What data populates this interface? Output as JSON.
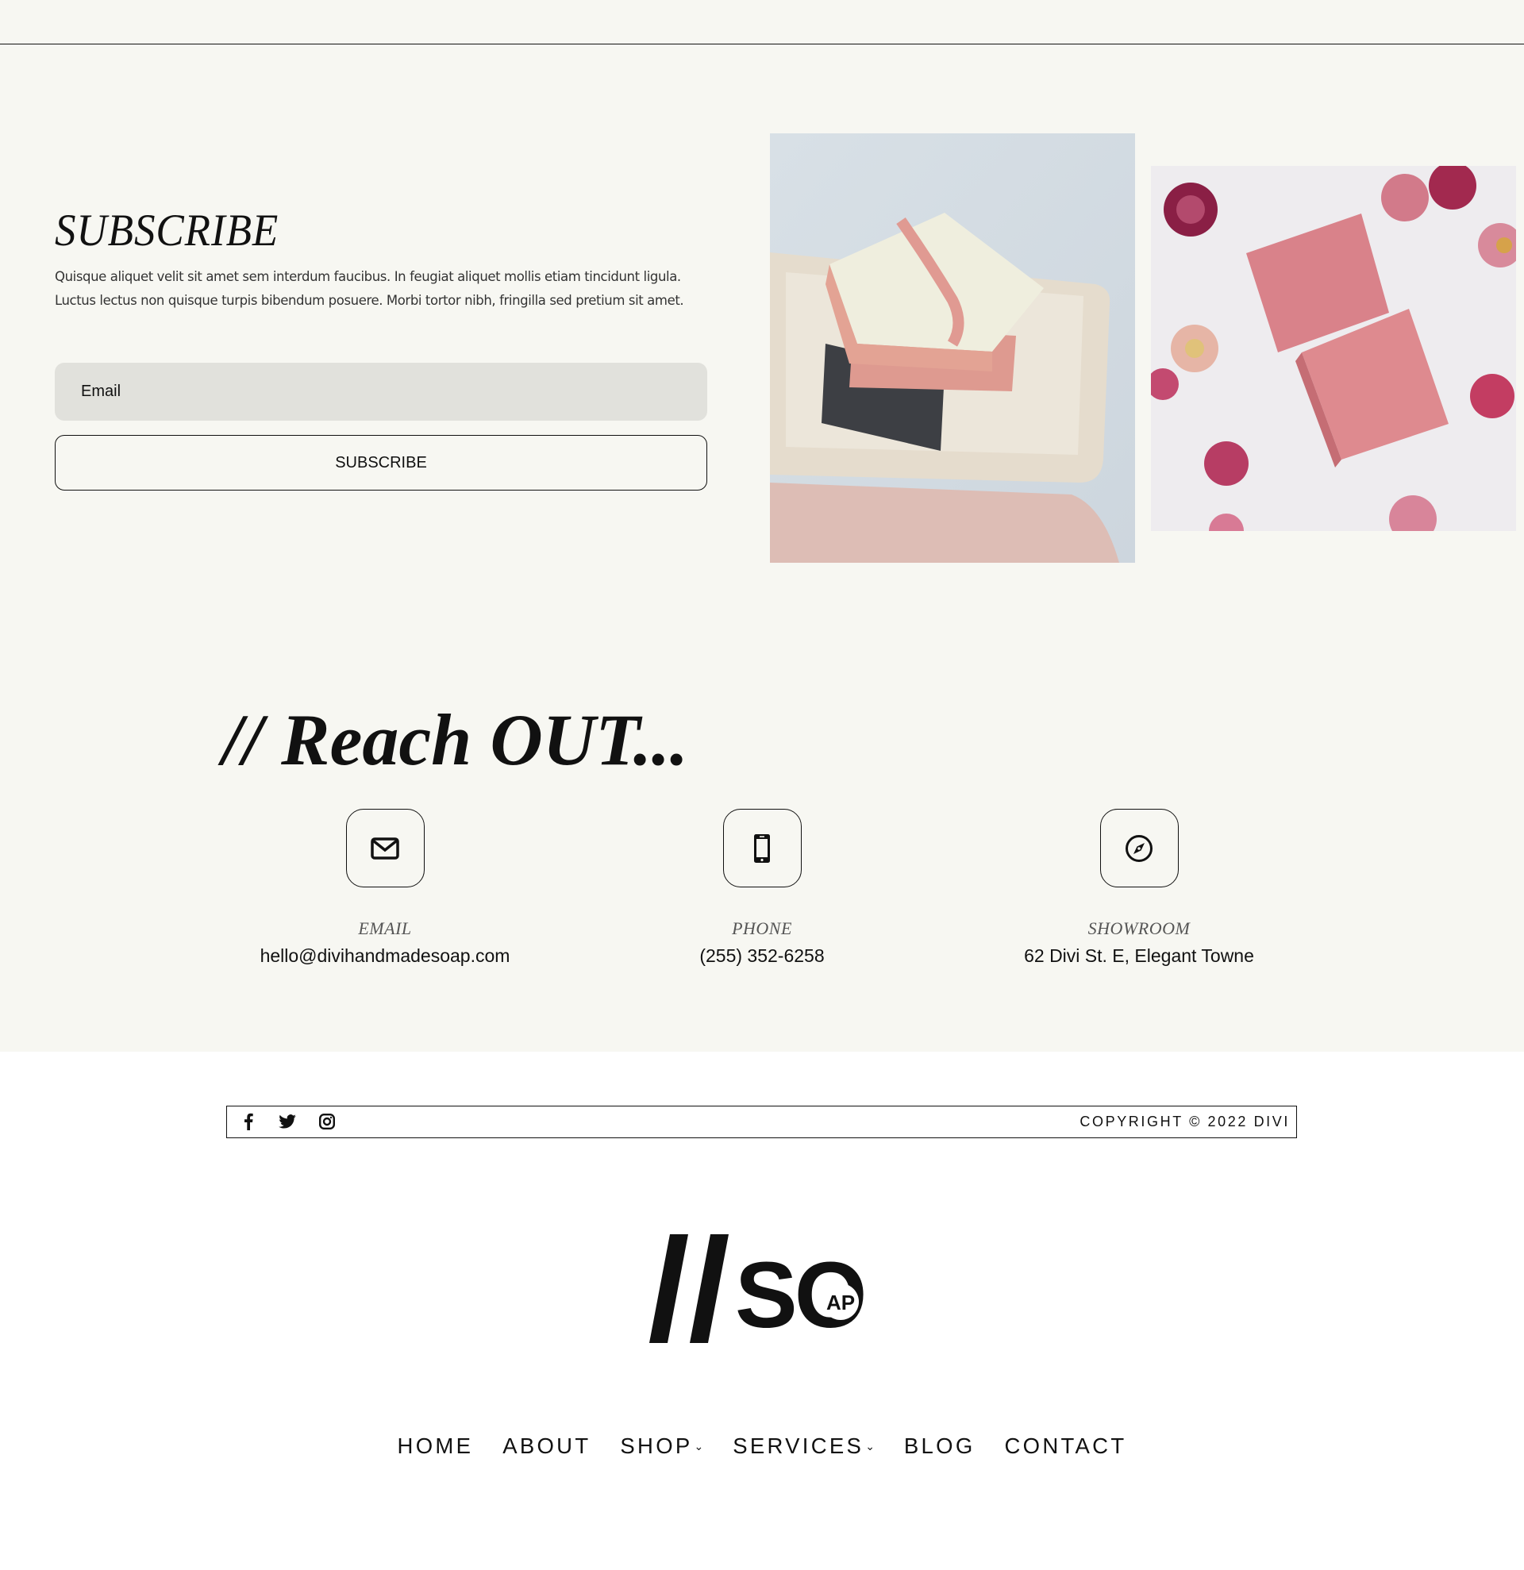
{
  "subscribe": {
    "title": "SUBSCRIBE",
    "text": "Quisque aliquet velit sit amet sem interdum faucibus. In feugiat aliquet mollis etiam tincidunt ligula. Luctus lectus non quisque turpis bibendum posuere. Morbi tortor nibh, fringilla sed pretium sit amet.",
    "email_placeholder": "Email",
    "email_value": "",
    "button_label": "SUBSCRIBE"
  },
  "images": [
    {
      "name": "stacked-soap-bars-photo",
      "alt": "Stacked handmade soap bars on a stone tray"
    },
    {
      "name": "pink-soap-with-flowers-photo",
      "alt": "Pink soap bars with dried flowers"
    }
  ],
  "reach": {
    "title": "// Reach OUT...",
    "items": [
      {
        "icon": "envelope-icon",
        "label": "EMAIL",
        "value": "hello@divihandmadesoap.com"
      },
      {
        "icon": "smartphone-icon",
        "label": "PHONE",
        "value": "(255) 352-6258"
      },
      {
        "icon": "compass-icon",
        "label": "SHOWROOM",
        "value": "62 Divi St. E, Elegant Towne"
      }
    ]
  },
  "footer": {
    "social": [
      {
        "icon": "facebook-icon",
        "label": "Facebook"
      },
      {
        "icon": "twitter-icon",
        "label": "Twitter"
      },
      {
        "icon": "instagram-icon",
        "label": "Instagram"
      }
    ],
    "copyright": "COPYRIGHT © 2022 DIVI"
  },
  "logo": {
    "slashes": "//",
    "main": "SO",
    "inner": "AP"
  },
  "nav": {
    "items": [
      {
        "label": "HOME",
        "has_dropdown": false
      },
      {
        "label": "ABOUT",
        "has_dropdown": false
      },
      {
        "label": "SHOP",
        "has_dropdown": true
      },
      {
        "label": "SERVICES",
        "has_dropdown": true
      },
      {
        "label": "BLOG",
        "has_dropdown": false
      },
      {
        "label": "CONTACT",
        "has_dropdown": false
      }
    ],
    "dropdown_glyph": "⌄"
  },
  "colors": {
    "page_beige": "#f7f7f2",
    "input_gray": "#e1e1dc",
    "text_dark": "#111111"
  }
}
